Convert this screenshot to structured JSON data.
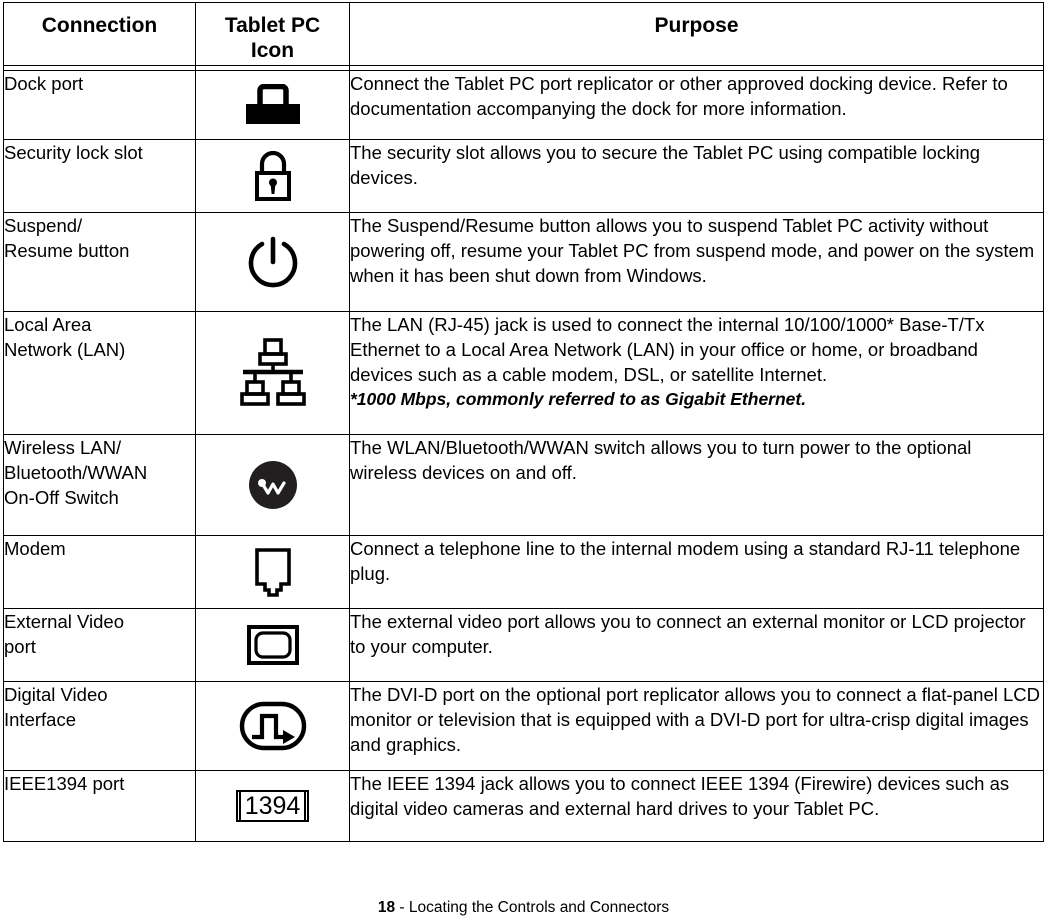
{
  "table": {
    "headers": {
      "connection": "Connection",
      "icon_line1": "Tablet PC",
      "icon_line2": "Icon",
      "purpose": "Purpose"
    },
    "rows": [
      {
        "connection": "Dock port",
        "icon_name": "dock-port-icon",
        "purpose": "Connect the Tablet PC port replicator or other approved docking device. Refer to documentation accompanying the dock for more information."
      },
      {
        "connection": "Security lock slot",
        "icon_name": "padlock-icon",
        "purpose": "The security slot allows you to secure the Tablet PC using compatible locking devices."
      },
      {
        "connection": "Suspend/\nResume button",
        "connection_line1": "Suspend/",
        "connection_line2": "Resume button",
        "icon_name": "power-button-icon",
        "purpose": "The Suspend/Resume button allows you to suspend Tablet PC activity without powering off, resume your Tablet PC from suspend mode, and power on the system when it has been shut down from Windows."
      },
      {
        "connection_line1": "Local Area",
        "connection_line2": "Network (LAN)",
        "icon_name": "network-lan-icon",
        "purpose": "The LAN (RJ-45) jack is used to connect the internal 10/100/1000* Base-T/Tx Ethernet to a Local Area Network (LAN) in your office or home, or broadband devices such as a cable modem, DSL, or satellite Internet.",
        "note": "*1000 Mbps, commonly referred to as Gigabit Ethernet."
      },
      {
        "connection_line1": "Wireless LAN/",
        "connection_line2": "Bluetooth/WWAN",
        "connection_line3": "On-Off Switch",
        "icon_name": "wireless-switch-icon",
        "purpose": "The WLAN/Bluetooth/WWAN switch allows you to turn power to the optional wireless devices on and off."
      },
      {
        "connection": "Modem",
        "icon_name": "modem-jack-icon",
        "purpose": "Connect a telephone line to the internal modem using a standard RJ-11 telephone plug."
      },
      {
        "connection_line1": "External Video",
        "connection_line2": "port",
        "icon_name": "external-video-monitor-icon",
        "purpose": "The external video port allows you to connect an external monitor or LCD projector to your computer."
      },
      {
        "connection_line1": "Digital Video",
        "connection_line2": "Interface",
        "icon_name": "dvi-icon",
        "purpose": "The DVI-D port on the optional port replicator allows you to connect a flat-panel LCD monitor or television that is equipped with a DVI-D port for ultra-crisp digital images and graphics."
      },
      {
        "connection": "IEEE1394 port",
        "icon_name": "ieee1394-icon",
        "icon_label": "1394",
        "purpose": "The IEEE 1394 jack allows you to connect IEEE 1394 (Firewire) devices such as digital video cameras and external hard drives to your Tablet PC."
      }
    ]
  },
  "footer": {
    "page_number": "18",
    "separator": " - ",
    "section": "Locating the Controls and Connectors"
  },
  "colors": {
    "ink": "#000000",
    "paper": "#ffffff"
  }
}
